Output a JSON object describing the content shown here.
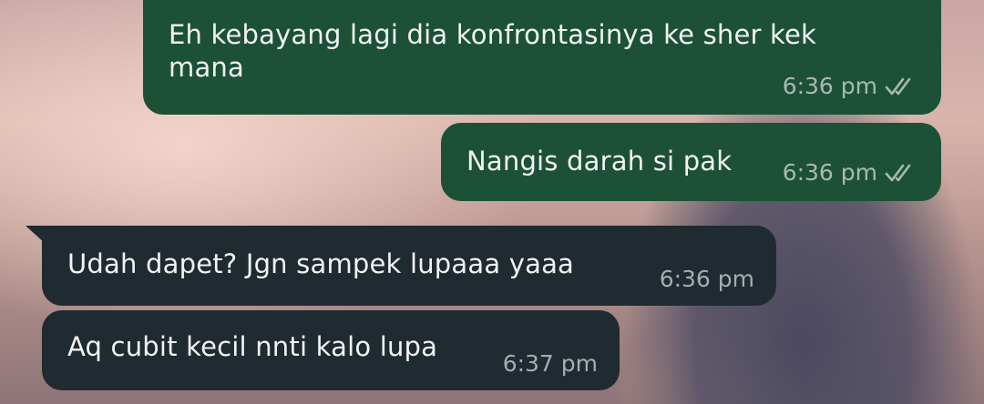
{
  "messages": [
    {
      "direction": "outgoing",
      "text": "Eh kebayang lagi dia konfrontasinya ke sher kek mana",
      "time": "6:36 pm",
      "status_icon": "double-check-icon"
    },
    {
      "direction": "outgoing",
      "text": "Nangis darah si pak",
      "time": "6:36 pm",
      "status_icon": "double-check-icon"
    },
    {
      "direction": "incoming",
      "text": "Udah dapet? Jgn sampek lupaaa yaaa",
      "time": "6:36 pm"
    },
    {
      "direction": "incoming",
      "text": "Aq cubit kecil nnti kalo lupa",
      "time": "6:37 pm"
    }
  ],
  "colors": {
    "outgoing_bubble": "#1c5138",
    "incoming_bubble": "#1f2b30",
    "message_text": "#f2f2f2",
    "timestamp": "#a9b8b2"
  }
}
